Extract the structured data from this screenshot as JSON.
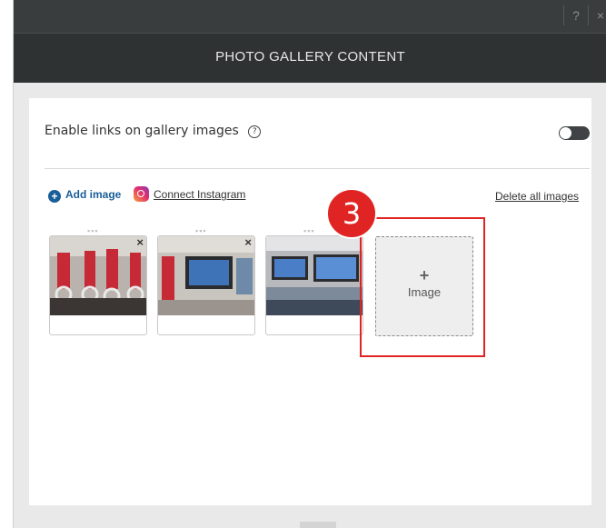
{
  "window": {
    "help_label": "?",
    "close_label": "×"
  },
  "header": {
    "title": "PHOTO GALLERY CONTENT"
  },
  "settings": {
    "enable_links_label": "Enable links on gallery images",
    "help_icon": "?",
    "toggle_state": "off"
  },
  "actions": {
    "add_image_label": "Add image",
    "connect_instagram_label": "Connect Instagram",
    "delete_all_label": "Delete all images"
  },
  "gallery": {
    "drag_handle": "▪▪▪",
    "images": [
      {
        "name": "image-1",
        "remove_label": "×"
      },
      {
        "name": "image-2",
        "remove_label": "×"
      },
      {
        "name": "image-3",
        "remove_label": ""
      }
    ],
    "add_tile": {
      "plus": "+",
      "label": "Image"
    }
  },
  "annotation": {
    "step_number": "3",
    "color": "#e02424"
  }
}
